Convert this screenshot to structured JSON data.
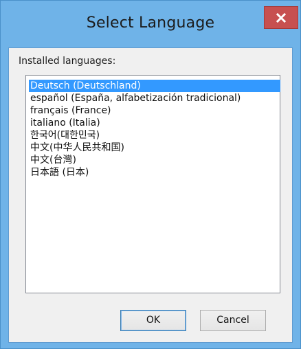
{
  "window": {
    "title": "Select Language",
    "accent_color": "#6fb3e8",
    "close_icon": "close-icon"
  },
  "content": {
    "label": "Installed languages:",
    "languages": [
      "Deutsch (Deutschland)",
      "español (España, alfabetización tradicional)",
      "français (France)",
      "italiano (Italia)",
      "한국어(대한민국)",
      "中文(中华人民共和国)",
      "中文(台灣)",
      "日本語 (日本)"
    ],
    "selected_index": 0
  },
  "buttons": {
    "ok": "OK",
    "cancel": "Cancel"
  }
}
